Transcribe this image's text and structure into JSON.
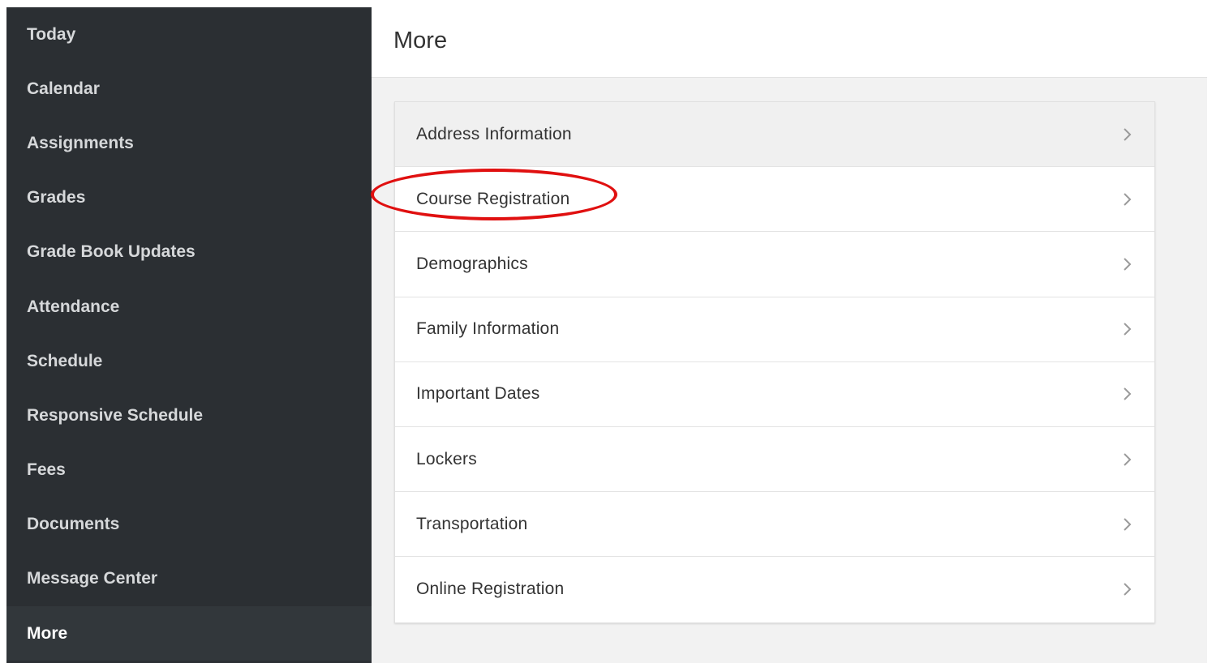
{
  "sidebar": {
    "items": [
      {
        "label": "Today"
      },
      {
        "label": "Calendar"
      },
      {
        "label": "Assignments"
      },
      {
        "label": "Grades"
      },
      {
        "label": "Grade Book Updates"
      },
      {
        "label": "Attendance"
      },
      {
        "label": "Schedule"
      },
      {
        "label": "Responsive Schedule"
      },
      {
        "label": "Fees"
      },
      {
        "label": "Documents"
      },
      {
        "label": "Message Center"
      },
      {
        "label": "More"
      }
    ],
    "active": "More"
  },
  "header": {
    "title": "More"
  },
  "main": {
    "items": [
      {
        "label": "Address Information",
        "icon": "chevron-right-icon"
      },
      {
        "label": "Course Registration",
        "icon": "chevron-right-icon"
      },
      {
        "label": "Demographics",
        "icon": "chevron-right-icon"
      },
      {
        "label": "Family Information",
        "icon": "chevron-right-icon"
      },
      {
        "label": "Important Dates",
        "icon": "chevron-right-icon"
      },
      {
        "label": "Lockers",
        "icon": "chevron-right-icon"
      },
      {
        "label": "Transportation",
        "icon": "chevron-right-icon"
      },
      {
        "label": "Online Registration",
        "icon": "chevron-right-icon"
      }
    ]
  },
  "annotation": {
    "color": "#e01010",
    "target": "Course Registration"
  },
  "colors": {
    "sidebar_bg": "#2b2f33",
    "sidebar_active_bg": "#32373b",
    "content_bg": "#f2f2f2"
  }
}
